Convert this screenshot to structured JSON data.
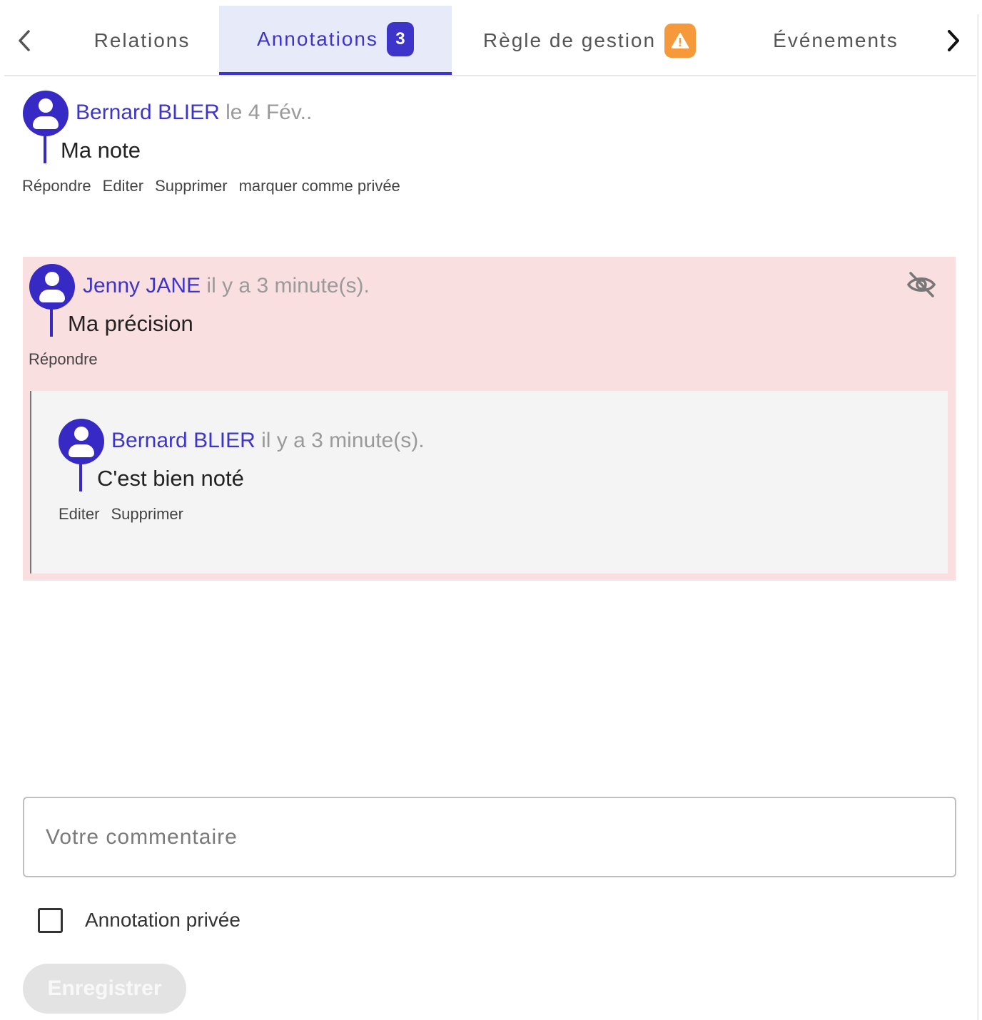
{
  "tabs": [
    {
      "label": "Relations"
    },
    {
      "label": "Annotations",
      "badge": "3"
    },
    {
      "label": "Règle de gestion",
      "badge": "!"
    },
    {
      "label": "Événements"
    }
  ],
  "active_tab": "Annotations",
  "comments": [
    {
      "author": "Bernard BLIER",
      "when": "le 4 Fév..",
      "text": "Ma note",
      "actions": [
        "Répondre",
        "Editer",
        "Supprimer",
        "marquer comme privée"
      ]
    },
    {
      "author": "Jenny JANE",
      "when": "il y a 3 minute(s).",
      "text": "Ma précision",
      "private": true,
      "actions": [
        "Répondre"
      ],
      "replies": [
        {
          "author": "Bernard BLIER",
          "when": "il y a 3 minute(s).",
          "text": "C'est bien noté",
          "actions": [
            "Editer",
            "Supprimer"
          ]
        }
      ]
    }
  ],
  "form": {
    "placeholder": "Votre commentaire",
    "value": "",
    "private_label": "Annotation privée",
    "private_checked": false,
    "save_label": "Enregistrer",
    "save_enabled": false
  },
  "colors": {
    "accent": "#3d35c9",
    "warning": "#f5993a",
    "private_bg": "#f9dfe0",
    "reply_bg": "#f4f4f4"
  },
  "icons": {
    "prev": "chevron-left-icon",
    "next": "chevron-right-icon",
    "warning": "warning-icon",
    "private": "eye-off-icon",
    "avatar": "user-avatar-icon"
  }
}
